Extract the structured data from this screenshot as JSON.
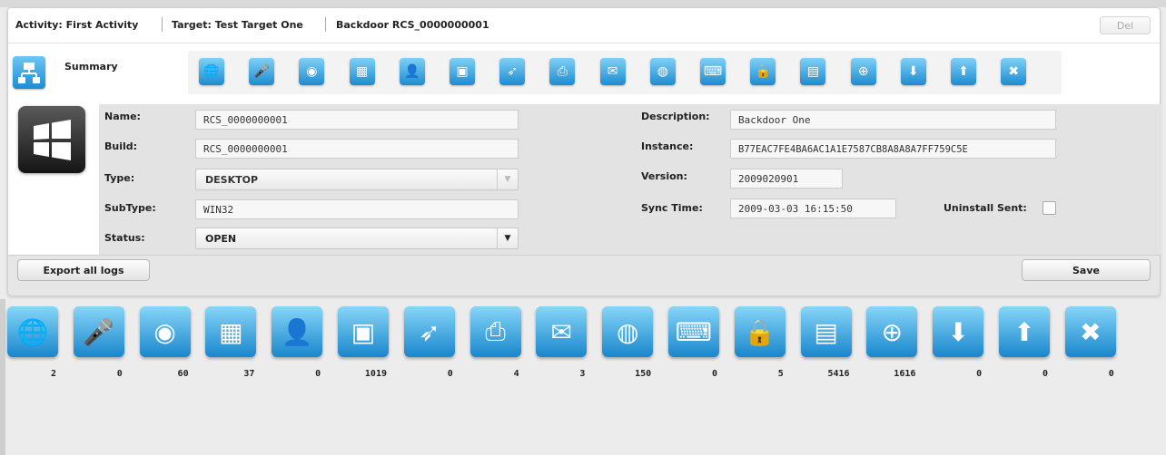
{
  "breadcrumb": {
    "activity": "Activity: First Activity",
    "target": "Target: Test Target One",
    "backdoor": "Backdoor RCS_0000000001",
    "delete_label": "Del"
  },
  "summary": {
    "label": "Summary"
  },
  "small_icons": [
    "chat-icon",
    "microphone-icon",
    "webcam-icon",
    "applications-icon",
    "contacts-icon",
    "screenshot-icon",
    "mouse-icon",
    "print-icon",
    "mail-icon",
    "url-icon",
    "keylog-icon",
    "password-icon",
    "file-icon",
    "file-capture-icon",
    "download-icon",
    "upload-icon",
    "settings-icon"
  ],
  "form": {
    "name_label": "Name:",
    "name_value": "RCS_0000000001",
    "build_label": "Build:",
    "build_value": "RCS_0000000001",
    "type_label": "Type:",
    "type_value": "DESKTOP",
    "subtype_label": "SubType:",
    "subtype_value": "WIN32",
    "status_label": "Status:",
    "status_value": "OPEN",
    "description_label": "Description:",
    "description_value": "Backdoor One",
    "instance_label": "Instance:",
    "instance_value": "B77EAC7FE4BA6AC1A1E7587CB8A8A8A7FF759C5E",
    "version_label": "Version:",
    "version_value": "2009020901",
    "sync_label": "Sync Time:",
    "sync_value": "2009-03-03 16:15:50",
    "uninstall_label": "Uninstall Sent:",
    "uninstall_checked": false
  },
  "buttons": {
    "export": "Export all logs",
    "save": "Save"
  },
  "evidence": [
    {
      "icon": "chat-icon",
      "count": "2"
    },
    {
      "icon": "microphone-icon",
      "count": "0"
    },
    {
      "icon": "webcam-icon",
      "count": "60"
    },
    {
      "icon": "applications-icon",
      "count": "37"
    },
    {
      "icon": "contacts-icon",
      "count": "0"
    },
    {
      "icon": "screenshot-icon",
      "count": "1019"
    },
    {
      "icon": "mouse-icon",
      "count": "0"
    },
    {
      "icon": "print-icon",
      "count": "4"
    },
    {
      "icon": "mail-icon",
      "count": "3"
    },
    {
      "icon": "url-icon",
      "count": "150"
    },
    {
      "icon": "keylog-icon",
      "count": "0"
    },
    {
      "icon": "password-icon",
      "count": "5"
    },
    {
      "icon": "file-icon",
      "count": "5416"
    },
    {
      "icon": "file-capture-icon",
      "count": "1616"
    },
    {
      "icon": "download-icon",
      "count": "0"
    },
    {
      "icon": "upload-icon",
      "count": "0"
    },
    {
      "icon": "settings-icon",
      "count": "0"
    }
  ],
  "colors": {
    "accent": "#1e8bd0",
    "accent_light": "#7fd0f6"
  }
}
